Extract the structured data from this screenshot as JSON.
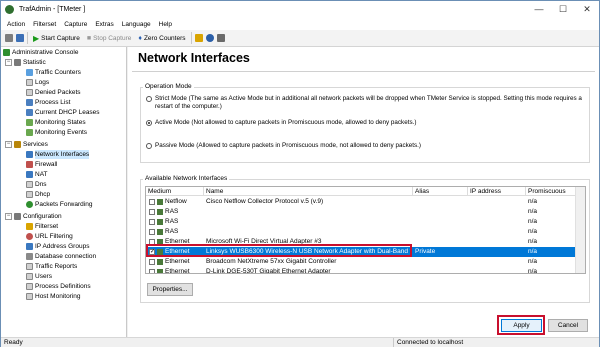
{
  "window": {
    "title": "TrafAdmin - [TMeter ]",
    "min": "—",
    "max": "☐",
    "close": "✕"
  },
  "menu": [
    "Action",
    "Filterset",
    "Capture",
    "Extras",
    "Language",
    "Help"
  ],
  "toolbar": {
    "start_capture": "Start Capture",
    "stop_capture": "Stop Capture",
    "zero_counters": "Zero Counters"
  },
  "tree": {
    "root": "Administrative Console",
    "statistic": "Statistic",
    "statistic_items": [
      "Traffic Counters",
      "Logs",
      "Denied Packets",
      "Process List",
      "Current DHCP Leases",
      "Monitoring States",
      "Monitoring Events"
    ],
    "services": "Services",
    "services_items": [
      "Network Interfaces",
      "Firewall",
      "NAT",
      "Dns",
      "Dhcp",
      "Packets Forwarding"
    ],
    "configuration": "Configuration",
    "configuration_items": [
      "Filterset",
      "URL Filtering",
      "IP Address Groups",
      "Database connection",
      "Traffic Reports",
      "Users",
      "Process Definitions",
      "Host Monitoring"
    ]
  },
  "page": {
    "title": "Network Interfaces"
  },
  "operation_mode": {
    "label": "Operation Mode",
    "strict_line1": "Strict Mode (The same as Active Mode but in additional all network packets will be dropped when TMeter Service is stopped. Setting this mode requires a",
    "strict_line2": "restart of the computer.)",
    "active": "Active Mode (Not allowed to capture packets in Promiscuous mode, allowed to deny packets.)",
    "passive": "Passive Mode (Allowed to capture packets in Promiscuous mode, not allowed to deny packets.)"
  },
  "interfaces": {
    "label": "Available Network Interfaces",
    "columns": [
      "Medium",
      "Name",
      "Alias",
      "IP address",
      "Promiscuous"
    ],
    "rows": [
      {
        "medium": "Netflow",
        "name": "Cisco Netflow Collector Protocol v.5 (v.9)",
        "alias": "",
        "ip": "",
        "promiscuous": "n/a",
        "checked": false,
        "selected": false
      },
      {
        "medium": "RAS",
        "name": "",
        "alias": "",
        "ip": "",
        "promiscuous": "n/a",
        "checked": false,
        "selected": false
      },
      {
        "medium": "RAS",
        "name": "",
        "alias": "",
        "ip": "",
        "promiscuous": "n/a",
        "checked": false,
        "selected": false
      },
      {
        "medium": "RAS",
        "name": "",
        "alias": "",
        "ip": "",
        "promiscuous": "n/a",
        "checked": false,
        "selected": false
      },
      {
        "medium": "Ethernet",
        "name": "Microsoft Wi-Fi Direct Virtual Adapter #3",
        "alias": "",
        "ip": "",
        "promiscuous": "n/a",
        "checked": false,
        "selected": false
      },
      {
        "medium": "Ethernet",
        "name": "Linksys WUSB6300 Wireless-N USB Network Adapter with Dual-Band ver...",
        "alias": "Private",
        "ip": "",
        "promiscuous": "n/a",
        "checked": true,
        "selected": true
      },
      {
        "medium": "Ethernet",
        "name": "Broadcom NetXtreme 57xx Gigabit Controller",
        "alias": "",
        "ip": "",
        "promiscuous": "n/a",
        "checked": false,
        "selected": false
      },
      {
        "medium": "Ethernet",
        "name": "D-Link DGE-530T Gigabit Ethernet Adapter",
        "alias": "",
        "ip": "",
        "promiscuous": "n/a",
        "checked": false,
        "selected": false
      }
    ]
  },
  "buttons": {
    "properties": "Properties...",
    "apply": "Apply",
    "cancel": "Cancel"
  },
  "status": {
    "left": "Ready",
    "right": "Connected to localhost"
  }
}
